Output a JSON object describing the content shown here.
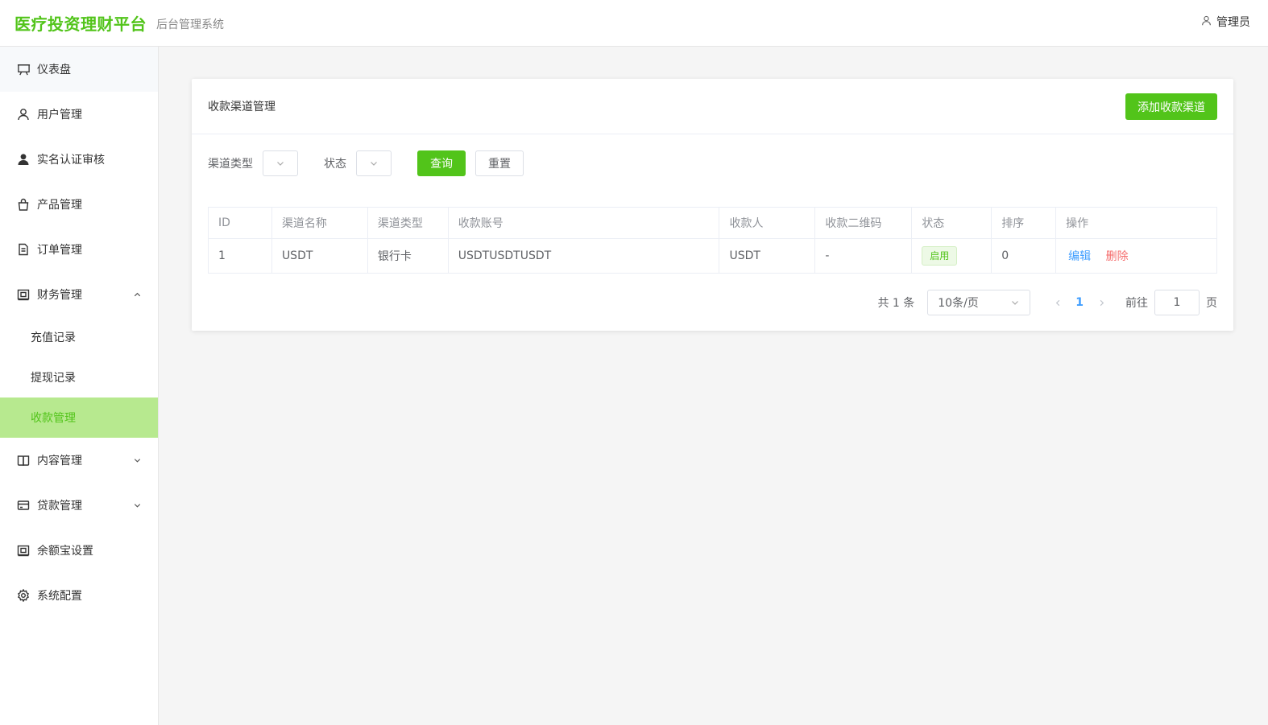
{
  "header": {
    "brand": "医疗投资理财平台",
    "subtitle": "后台管理系统",
    "user": "管理员"
  },
  "sidebar": {
    "items": [
      {
        "label": "仪表盘",
        "icon": "presentation-icon"
      },
      {
        "label": "用户管理",
        "icon": "user-icon"
      },
      {
        "label": "实名认证审核",
        "icon": "person-filled-icon"
      },
      {
        "label": "产品管理",
        "icon": "shopping-bag-icon"
      },
      {
        "label": "订单管理",
        "icon": "document-icon"
      },
      {
        "label": "财务管理",
        "icon": "wallet-icon",
        "expanded": true
      },
      {
        "label": "内容管理",
        "icon": "book-icon"
      },
      {
        "label": "贷款管理",
        "icon": "credit-card-icon"
      },
      {
        "label": "余额宝设置",
        "icon": "wallet-icon"
      },
      {
        "label": "系统配置",
        "icon": "gear-icon"
      }
    ],
    "finance_sub": [
      {
        "label": "充值记录"
      },
      {
        "label": "提现记录"
      },
      {
        "label": "收款管理",
        "active": true
      }
    ]
  },
  "card": {
    "title": "收款渠道管理",
    "add_button": "添加收款渠道"
  },
  "filters": {
    "channel_type_label": "渠道类型",
    "status_label": "状态",
    "query_button": "查询",
    "reset_button": "重置"
  },
  "table": {
    "headers": [
      "ID",
      "渠道名称",
      "渠道类型",
      "收款账号",
      "收款人",
      "收款二维码",
      "状态",
      "排序",
      "操作"
    ],
    "rows": [
      {
        "id": "1",
        "name": "USDT",
        "type": "银行卡",
        "account": "USDTUSDTUSDT",
        "payee": "USDT",
        "qrcode": "-",
        "status": "启用",
        "sort": "0",
        "edit": "编辑",
        "delete": "删除"
      }
    ]
  },
  "pagination": {
    "total": "共 1 条",
    "page_size": "10条/页",
    "current_page": "1",
    "goto_label": "前往",
    "goto_value": "1",
    "page_suffix": "页"
  },
  "colors": {
    "accent": "#52c41a",
    "active_bg": "#b7e98f",
    "link": "#409eff",
    "danger": "#f56c6c"
  }
}
